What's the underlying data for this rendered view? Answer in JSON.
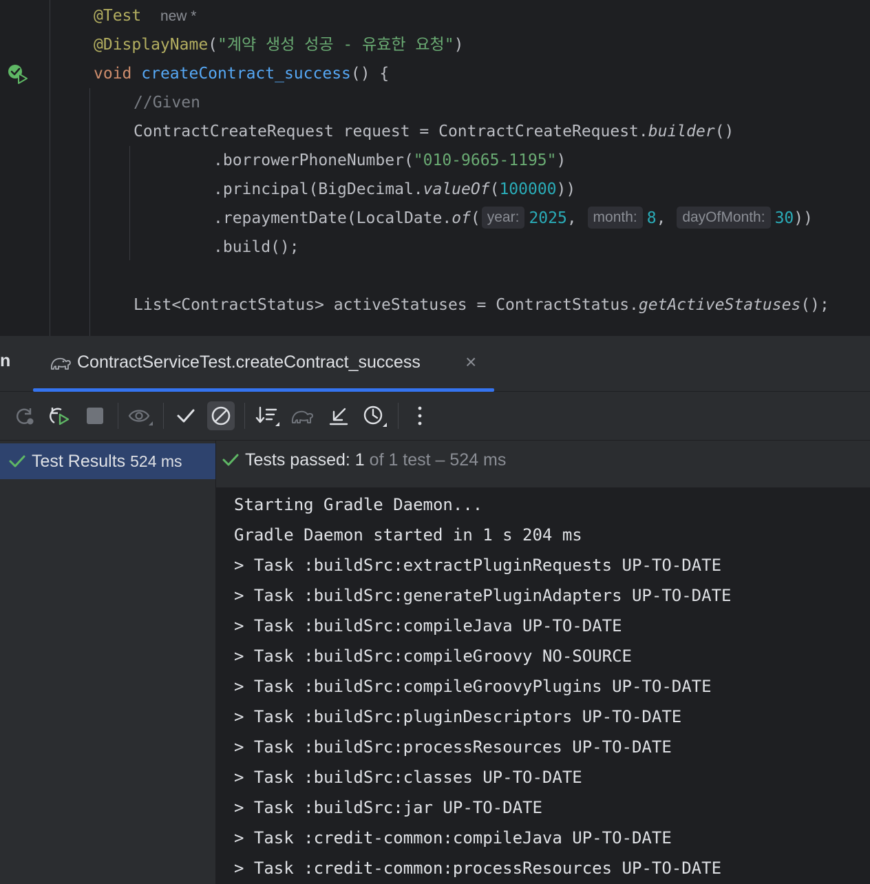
{
  "editor": {
    "annotation_test": "@Test",
    "new_marker": "new *",
    "display_name_annotation": "@DisplayName",
    "display_name_open": "(",
    "display_name_string": "\"계약 생성 성공 - 유효한 요청\"",
    "display_name_close": ")",
    "method_modifier": "void",
    "method_name": "createContract_success",
    "method_signature_rest": "() {",
    "comment_given": "//Given",
    "line_request_decl": "ContractCreateRequest request = ContractCreateRequest.",
    "line_request_builder": "builder",
    "line_request_end": "()",
    "line_phone_prefix": ".borrowerPhoneNumber(",
    "line_phone_value": "\"010-9665-1195\"",
    "line_phone_suffix": ")",
    "line_principal_prefix": ".principal(BigDecimal.",
    "line_principal_method": "valueOf",
    "line_principal_open": "(",
    "line_principal_value": "100000",
    "line_principal_suffix": "))",
    "line_repay_prefix": ".repaymentDate(LocalDate.",
    "line_repay_method": "of",
    "line_repay_open": "(",
    "hint_year": "year:",
    "value_year": "2025",
    "comma_1": ",",
    "hint_month": "month:",
    "value_month": "8",
    "comma_2": ",",
    "hint_day": "dayOfMonth:",
    "value_day": "30",
    "line_repay_suffix": "))",
    "line_build": ".build();",
    "line_statuses_decl": "List<ContractStatus> activeStatuses = ContractStatus.",
    "line_statuses_method": "getActiveStatuses",
    "line_statuses_end": "();"
  },
  "run_panel": {
    "left_tab_fragment": "n",
    "active_tab_title": "ContractServiceTest.createContract_success",
    "close_glyph": "×",
    "toolbar_icons": [
      "rerun-icon",
      "rerun-failed-icon",
      "stop-icon",
      "show-passed-icon",
      "check-icon",
      "ignored-icon",
      "sort-icon",
      "gradle-icon",
      "collapse-icon",
      "history-icon",
      "more-options-icon"
    ],
    "tree": {
      "label": "Test Results",
      "time": "524 ms"
    },
    "status": {
      "main": "Tests passed: 1",
      "sub": " of 1 test – 524 ms"
    },
    "console_lines": [
      "Starting Gradle Daemon...",
      "Gradle Daemon started in 1 s 204 ms",
      "> Task :buildSrc:extractPluginRequests UP-TO-DATE",
      "> Task :buildSrc:generatePluginAdapters UP-TO-DATE",
      "> Task :buildSrc:compileJava UP-TO-DATE",
      "> Task :buildSrc:compileGroovy NO-SOURCE",
      "> Task :buildSrc:compileGroovyPlugins UP-TO-DATE",
      "> Task :buildSrc:pluginDescriptors UP-TO-DATE",
      "> Task :buildSrc:processResources UP-TO-DATE",
      "> Task :buildSrc:classes UP-TO-DATE",
      "> Task :buildSrc:jar UP-TO-DATE",
      "> Task :credit-common:compileJava UP-TO-DATE",
      "> Task :credit-common:processResources UP-TO-DATE"
    ]
  },
  "colors": {
    "editor_bg": "#1e1f22",
    "panel_bg": "#2b2d30",
    "accent": "#3574f0",
    "success": "#5fb865",
    "selected_row": "#2e436e"
  }
}
